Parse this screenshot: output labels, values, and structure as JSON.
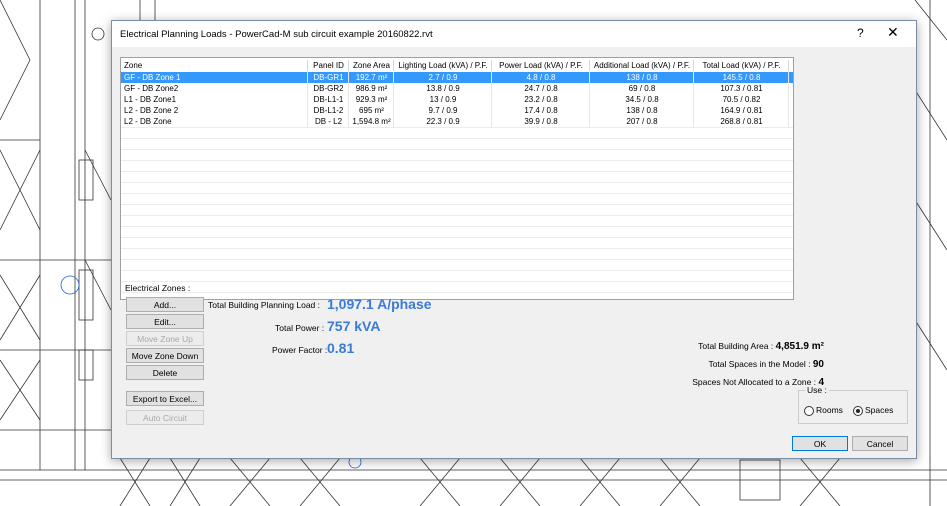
{
  "window": {
    "title": "Electrical Planning Loads - PowerCad-M sub circuit example 20160822.rvt",
    "help_glyph": "?",
    "close_glyph": "✕"
  },
  "table": {
    "columns": [
      "Zone",
      "Panel ID",
      "Zone Area",
      "Lighting Load (kVA) / P.F.",
      "Power Load (kVA) / P.F.",
      "Additional Load (kVA) / P.F.",
      "Total Load (kVA) / P.F."
    ],
    "rows": [
      [
        "GF - DB Zone 1",
        "DB-GR1",
        "192.7 m²",
        "2.7 / 0.9",
        "4.8 / 0.8",
        "138 / 0.8",
        "145.5 / 0.8"
      ],
      [
        "GF - DB Zone2",
        "DB-GR2",
        "986.9 m²",
        "13.8 / 0.9",
        "24.7 / 0.8",
        "69 / 0.8",
        "107.3 / 0.81"
      ],
      [
        "L1 - DB Zone1",
        "DB-L1-1",
        "929.3 m²",
        "13 / 0.9",
        "23.2 / 0.8",
        "34.5 / 0.8",
        "70.5 / 0.82"
      ],
      [
        "L2 - DB Zone 2",
        "DB-L1-2",
        "695 m²",
        "9.7 / 0.9",
        "17.4 / 0.8",
        "138 / 0.8",
        "164.9 / 0.81"
      ],
      [
        "L2 - DB Zone",
        "DB - L2",
        "1,594.8 m²",
        "22.3 / 0.9",
        "39.9 / 0.8",
        "207 / 0.8",
        "268.8 / 0.81"
      ]
    ],
    "selected_row": 0
  },
  "zones": {
    "label": "Electrical Zones :",
    "buttons": {
      "add": "Add...",
      "edit": "Edit...",
      "move_up": "Move Zone Up",
      "move_down": "Move Zone Down",
      "delete": "Delete",
      "export": "Export to Excel...",
      "auto_circuit": "Auto Circuit"
    }
  },
  "summary": {
    "planning_load_label": "Total Building Planning Load :",
    "planning_load_value": "1,097.1 A/phase",
    "total_power_label": "Total Power :",
    "total_power_value": "757 kVA",
    "power_factor_label": "Power Factor :",
    "power_factor_value": "0.81",
    "building_area_label": "Total Building Area :",
    "building_area_value": "4,851.9 m²",
    "spaces_label": "Total Spaces in the Model :",
    "spaces_value": "90",
    "unallocated_label": "Spaces Not Allocated to a Zone :",
    "unallocated_value": "4"
  },
  "use": {
    "label": "Use :",
    "options": [
      "Rooms",
      "Spaces"
    ],
    "selected": "Spaces"
  },
  "footer": {
    "ok": "OK",
    "cancel": "Cancel"
  },
  "colors": {
    "accent": "#3a7bd5",
    "selection": "#3399ff"
  }
}
